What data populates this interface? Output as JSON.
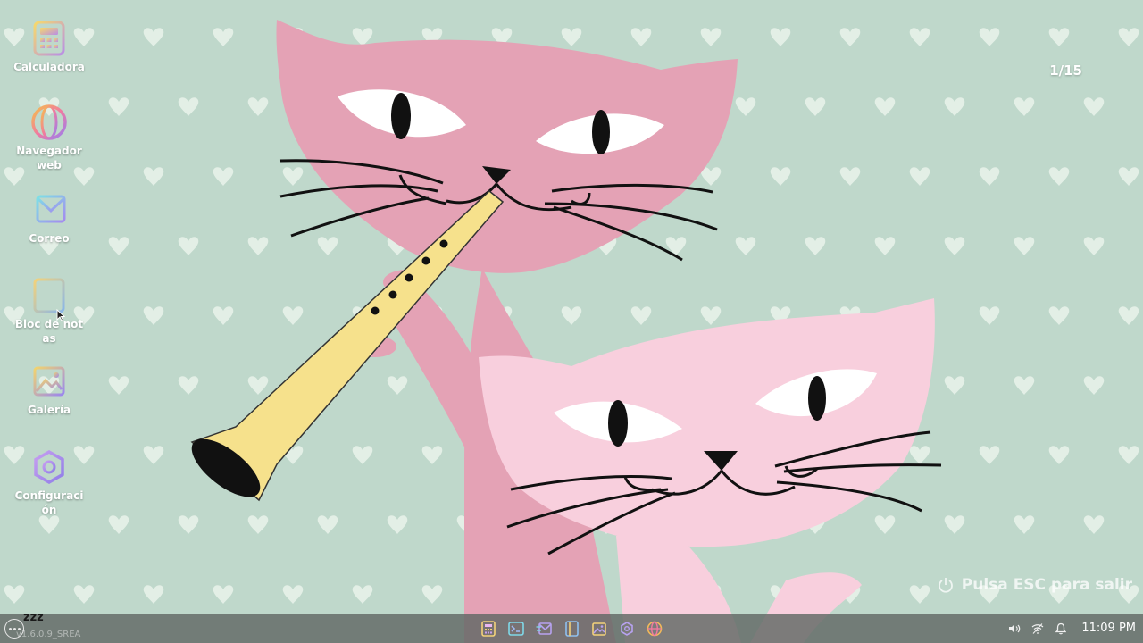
{
  "desktop": {
    "icons": [
      {
        "label": "Calculadora",
        "icon": "calculator-icon"
      },
      {
        "label": "Navegador web",
        "icon": "web-browser-icon"
      },
      {
        "label": "Correo",
        "icon": "mail-icon"
      },
      {
        "label": "Bloc de notas",
        "icon": "notepad-icon"
      },
      {
        "label": "Galería",
        "icon": "gallery-icon"
      },
      {
        "label": "Configuración",
        "icon": "settings-icon"
      }
    ],
    "slide_counter": "1/15",
    "esc_hint": "Pulsa ESC para salir",
    "sleep_indicator": "zzz",
    "version_text": "v1.6.0.9_SREA"
  },
  "taskbar": {
    "launcher_icon": "app-launcher-icon",
    "apps": [
      "calculator-icon",
      "terminal-icon",
      "mail-icon",
      "notepad-icon",
      "gallery-icon",
      "settings-icon",
      "web-browser-icon"
    ],
    "tray": [
      "volume-icon",
      "wifi-icon",
      "notification-bell-icon"
    ],
    "clock": "11:09 PM"
  },
  "colors": {
    "background": "#bfd8cb",
    "heart": "#e3efe6",
    "cat_dark": "#e4a2b5",
    "cat_light": "#f8cfdd",
    "clarinet": "#f6e18c",
    "taskbar": "#606864"
  }
}
